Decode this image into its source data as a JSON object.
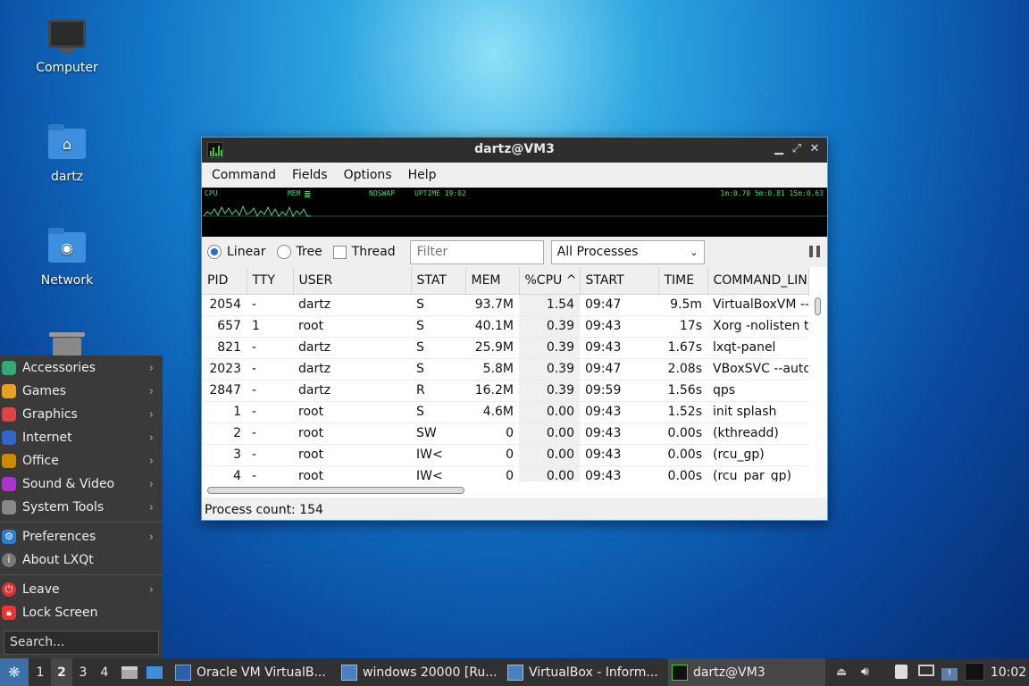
{
  "desktop": {
    "icons": [
      {
        "label": "Computer"
      },
      {
        "label": "dartz"
      },
      {
        "label": "Network"
      }
    ]
  },
  "window": {
    "title": "dartz@VM3",
    "menu": [
      "Command",
      "Fields",
      "Options",
      "Help"
    ],
    "graph": {
      "cpu": "CPU",
      "mem": "MEM",
      "noswap": "NOSWAP",
      "uptime": "UPTIME 19:02",
      "load": "1m:0.70 5m:0.81 15m:0.63"
    },
    "toolbar": {
      "linear": "Linear",
      "tree": "Tree",
      "thread": "Thread",
      "filter_placeholder": "Filter",
      "process_select": "All Processes"
    },
    "columns": [
      "PID",
      "TTY",
      "USER",
      "STAT",
      "MEM",
      "%CPU",
      "START",
      "TIME",
      "COMMAND_LINE"
    ],
    "rows": [
      [
        "2054",
        "-",
        "dartz",
        "S",
        "93.7M",
        "1.54",
        "09:47",
        "9.5m",
        "VirtualBoxVM --co"
      ],
      [
        "657",
        "1",
        "root",
        "S",
        "40.1M",
        "0.39",
        "09:43",
        "17s",
        "Xorg -nolisten tcp"
      ],
      [
        "821",
        "-",
        "dartz",
        "S",
        "25.9M",
        "0.39",
        "09:43",
        "1.67s",
        "lxqt-panel"
      ],
      [
        "2023",
        "-",
        "dartz",
        "S",
        "5.8M",
        "0.39",
        "09:47",
        "2.08s",
        "VBoxSVC --auto-s"
      ],
      [
        "2847",
        "-",
        "dartz",
        "R",
        "16.2M",
        "0.39",
        "09:59",
        "1.56s",
        "qps"
      ],
      [
        "1",
        "-",
        "root",
        "S",
        "4.6M",
        "0.00",
        "09:43",
        "1.52s",
        "init splash"
      ],
      [
        "2",
        "-",
        "root",
        "SW",
        "0",
        "0.00",
        "09:43",
        "0.00s",
        "(kthreadd)"
      ],
      [
        "3",
        "-",
        "root",
        "IW<",
        "0",
        "0.00",
        "09:43",
        "0.00s",
        "(rcu_gp)"
      ],
      [
        "4",
        "-",
        "root",
        "IW<",
        "0",
        "0.00",
        "09:43",
        "0.00s",
        "(rcu_par_gp)"
      ]
    ],
    "status": "Process count: 154"
  },
  "startmenu": {
    "items": [
      {
        "label": "Accessories",
        "icon": "accessories-icon",
        "color": "#3a7"
      },
      {
        "label": "Games",
        "icon": "games-icon",
        "color": "#e9a020"
      },
      {
        "label": "Graphics",
        "icon": "graphics-icon",
        "color": "#d44"
      },
      {
        "label": "Internet",
        "icon": "internet-icon",
        "color": "#36c"
      },
      {
        "label": "Office",
        "icon": "office-icon",
        "color": "#c80"
      },
      {
        "label": "Sound & Video",
        "icon": "sound-video-icon",
        "color": "#a3c"
      },
      {
        "label": "System Tools",
        "icon": "system-tools-icon",
        "color": "#888"
      }
    ],
    "preferences": "Preferences",
    "about": "About LXQt",
    "leave": "Leave",
    "lock": "Lock Screen",
    "search_placeholder": "Search..."
  },
  "taskbar": {
    "desktops": [
      "1",
      "2",
      "3",
      "4"
    ],
    "tasks": [
      {
        "label": "Oracle VM VirtualB..."
      },
      {
        "label": "windows 20000 [Ru..."
      },
      {
        "label": "VirtualBox - Inform..."
      },
      {
        "label": "dartz@VM3"
      }
    ],
    "clock": "10:02"
  }
}
